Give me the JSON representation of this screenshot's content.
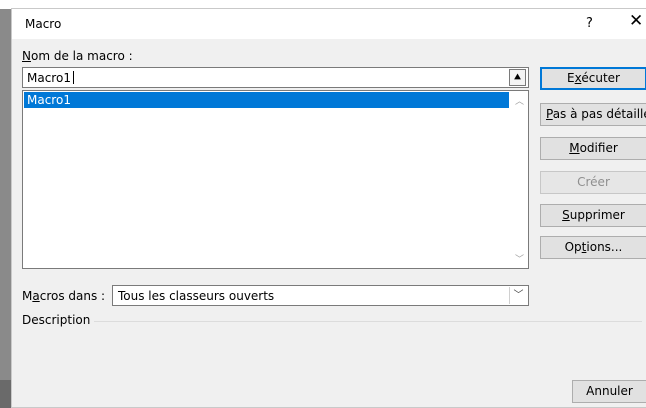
{
  "dialog": {
    "title": "Macro",
    "help_label": "?",
    "close_label": "✕"
  },
  "macro_name": {
    "label_accel": "N",
    "label_rest": "om de la macro :",
    "value": "Macro1",
    "upload_icon": "⯅"
  },
  "macro_list": {
    "items": [
      "Macro1"
    ],
    "selected": "Macro1"
  },
  "buttons": {
    "run": {
      "pre": "E",
      "accel": "x",
      "post": "écuter"
    },
    "step": {
      "pre": "",
      "accel": "P",
      "post": "as à pas détaillé"
    },
    "edit": {
      "pre": "",
      "accel": "M",
      "post": "odifier"
    },
    "create": {
      "label": "Créer"
    },
    "delete": {
      "pre": "",
      "accel": "S",
      "post": "upprimer"
    },
    "options": {
      "pre": "Op",
      "accel": "t",
      "post": "ions..."
    },
    "cancel": {
      "label": "Annuler"
    }
  },
  "macros_in": {
    "label_pre": "M",
    "label_accel": "a",
    "label_post": "cros dans :",
    "value": "Tous les classeurs ouverts"
  },
  "description": {
    "label": "Description"
  },
  "colors": {
    "accent": "#0078d7",
    "dialog_bg": "#f0f0f0",
    "button_bg": "#e1e1e1"
  }
}
